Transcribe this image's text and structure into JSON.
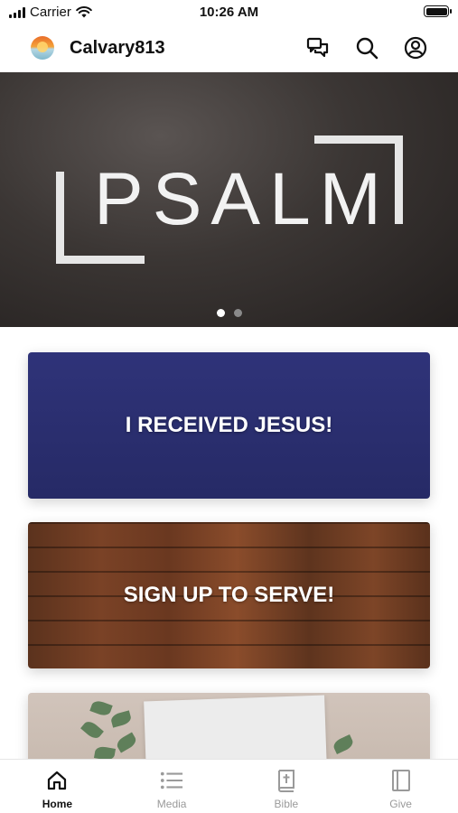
{
  "status_bar": {
    "carrier": "Carrier",
    "time": "10:26 AM"
  },
  "header": {
    "app_title": "Calvary813",
    "icons": [
      "chat-icon",
      "search-icon",
      "profile-icon"
    ]
  },
  "hero": {
    "title": "PSALM",
    "carousel_page": 1,
    "carousel_total": 2
  },
  "cards": [
    {
      "label": "I RECEIVED JESUS!"
    },
    {
      "label": "SIGN UP TO SERVE!"
    },
    {
      "label": ""
    }
  ],
  "tab_bar": {
    "items": [
      {
        "label": "Home",
        "icon": "home-icon",
        "active": true
      },
      {
        "label": "Media",
        "icon": "list-icon",
        "active": false
      },
      {
        "label": "Bible",
        "icon": "bible-icon",
        "active": false
      },
      {
        "label": "Give",
        "icon": "book-icon",
        "active": false
      }
    ]
  },
  "colors": {
    "card_blue": "#2b2f72",
    "tab_inactive": "#9a9a9a",
    "tab_active": "#111111"
  }
}
